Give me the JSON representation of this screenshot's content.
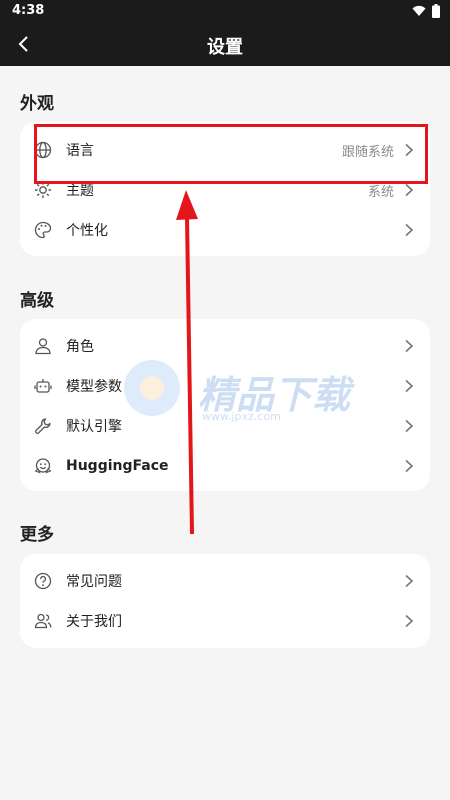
{
  "status_bar": {
    "time": "4:38"
  },
  "app_bar": {
    "title": "设置"
  },
  "sections": {
    "appearance": {
      "title": "外观",
      "items": [
        {
          "label": "语言",
          "value": "跟随系统",
          "icon": "globe-icon"
        },
        {
          "label": "主题",
          "value": "系统",
          "icon": "sun-icon"
        },
        {
          "label": "个性化",
          "value": "",
          "icon": "palette-icon"
        }
      ]
    },
    "advanced": {
      "title": "高级",
      "items": [
        {
          "label": "角色",
          "icon": "person-icon"
        },
        {
          "label": "模型参数",
          "icon": "robot-icon"
        },
        {
          "label": "默认引擎",
          "icon": "wrench-icon"
        },
        {
          "label": "HuggingFace",
          "icon": "huggingface-icon"
        }
      ]
    },
    "more": {
      "title": "更多",
      "items": [
        {
          "label": "常见问题",
          "icon": "question-icon"
        },
        {
          "label": "关于我们",
          "icon": "people-icon"
        }
      ]
    }
  },
  "watermark": {
    "text": "精品下载",
    "sub": "www.jpxz.com"
  },
  "colors": {
    "bar": "#1b1b1b",
    "background": "#f5f5f6",
    "annotation": "#e3161c"
  }
}
